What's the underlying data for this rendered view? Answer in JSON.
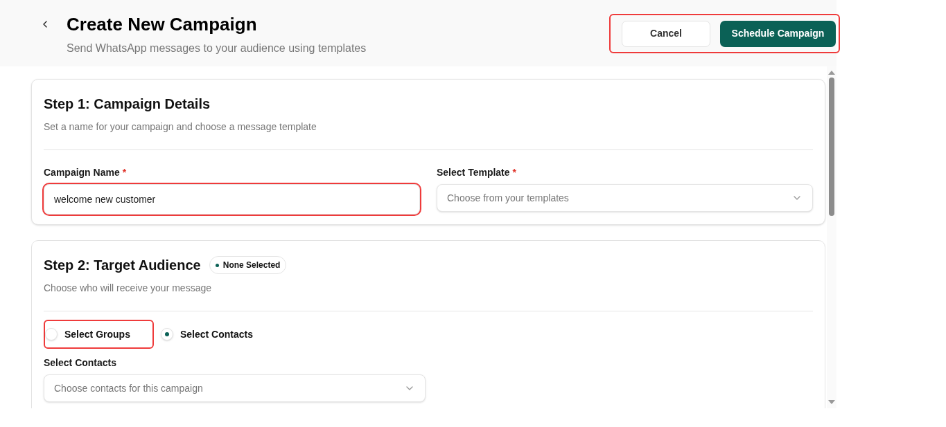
{
  "header": {
    "title": "Create New Campaign",
    "subtitle": "Send WhatsApp messages to your audience using templates"
  },
  "actions": {
    "highlighted": true,
    "buttons": [
      {
        "label": "Cancel",
        "kind": "secondary"
      },
      {
        "label": "Schedule Campaign",
        "kind": "primary"
      }
    ]
  },
  "step1": {
    "title": "Step 1: Campaign Details",
    "subtitle": "Set a name for your campaign and choose a message template",
    "fields": [
      {
        "label": "Campaign Name",
        "required_mark": "*",
        "kind": "text",
        "value": "welcome new customer",
        "highlighted": true
      },
      {
        "label": "Select Template",
        "required_mark": "*",
        "kind": "select",
        "placeholder": "Choose from your templates",
        "highlighted": false
      }
    ]
  },
  "step2": {
    "title": "Step 2: Target Audience",
    "badge": "None Selected",
    "subtitle": "Choose who will receive your message",
    "options": [
      {
        "label": "Select Groups",
        "selected": false,
        "highlighted": true
      },
      {
        "label": "Select Contacts",
        "selected": true,
        "highlighted": false
      }
    ],
    "field": {
      "label": "Select Contacts",
      "kind": "select",
      "placeholder": "Choose contacts for this campaign",
      "highlighted": false
    }
  }
}
